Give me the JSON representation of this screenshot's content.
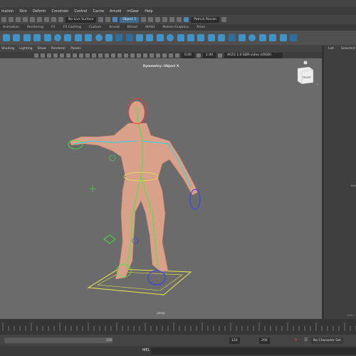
{
  "menubar": {
    "items": [
      "ination",
      "Skin",
      "Deform",
      "Constrain",
      "Control",
      "Cache",
      "Arnold",
      "mGear",
      "Help"
    ]
  },
  "statusline": {
    "live_surface": "No Live Surface",
    "object_field": "Object 1",
    "workspace": "Patrick Riocan"
  },
  "shelf": {
    "tabs": [
      "Animation",
      "Rendering",
      "FX",
      "FX Caching",
      "Custom",
      "Arnold",
      "Bifrost",
      "MASH",
      "Motion Graphics",
      "XGen"
    ]
  },
  "panel": {
    "menu": [
      "Shading",
      "Lighting",
      "Show",
      "Renderer",
      "Panels"
    ],
    "value_a": "0.00",
    "value_b": "1.00",
    "color_space": "ACES 1.0 SDR-video (sRGB)"
  },
  "viewport": {
    "symmetry_label": "Symmetry: Object X",
    "view_cube_label": "FRONT",
    "camera_label": "persp"
  },
  "right_panel": {
    "tab_list": "List",
    "tab_selected": "Selected",
    "edge_text": "Sele",
    "bottom_text": "Selec"
  },
  "range": {
    "current_start": "120",
    "end_a": "120",
    "end_b": "200",
    "character_set": "No Character Set"
  },
  "command": {
    "lang_label": "MEL"
  },
  "colors": {
    "shelf_icon": "#3f93c9",
    "viewport_bg": "#6b6b6b",
    "joint_green": "#3df03d",
    "joint_yellow": "#e8e84a",
    "control_blue": "#3a3aff",
    "control_red": "#ff3030",
    "skin": "#d9a08a"
  }
}
